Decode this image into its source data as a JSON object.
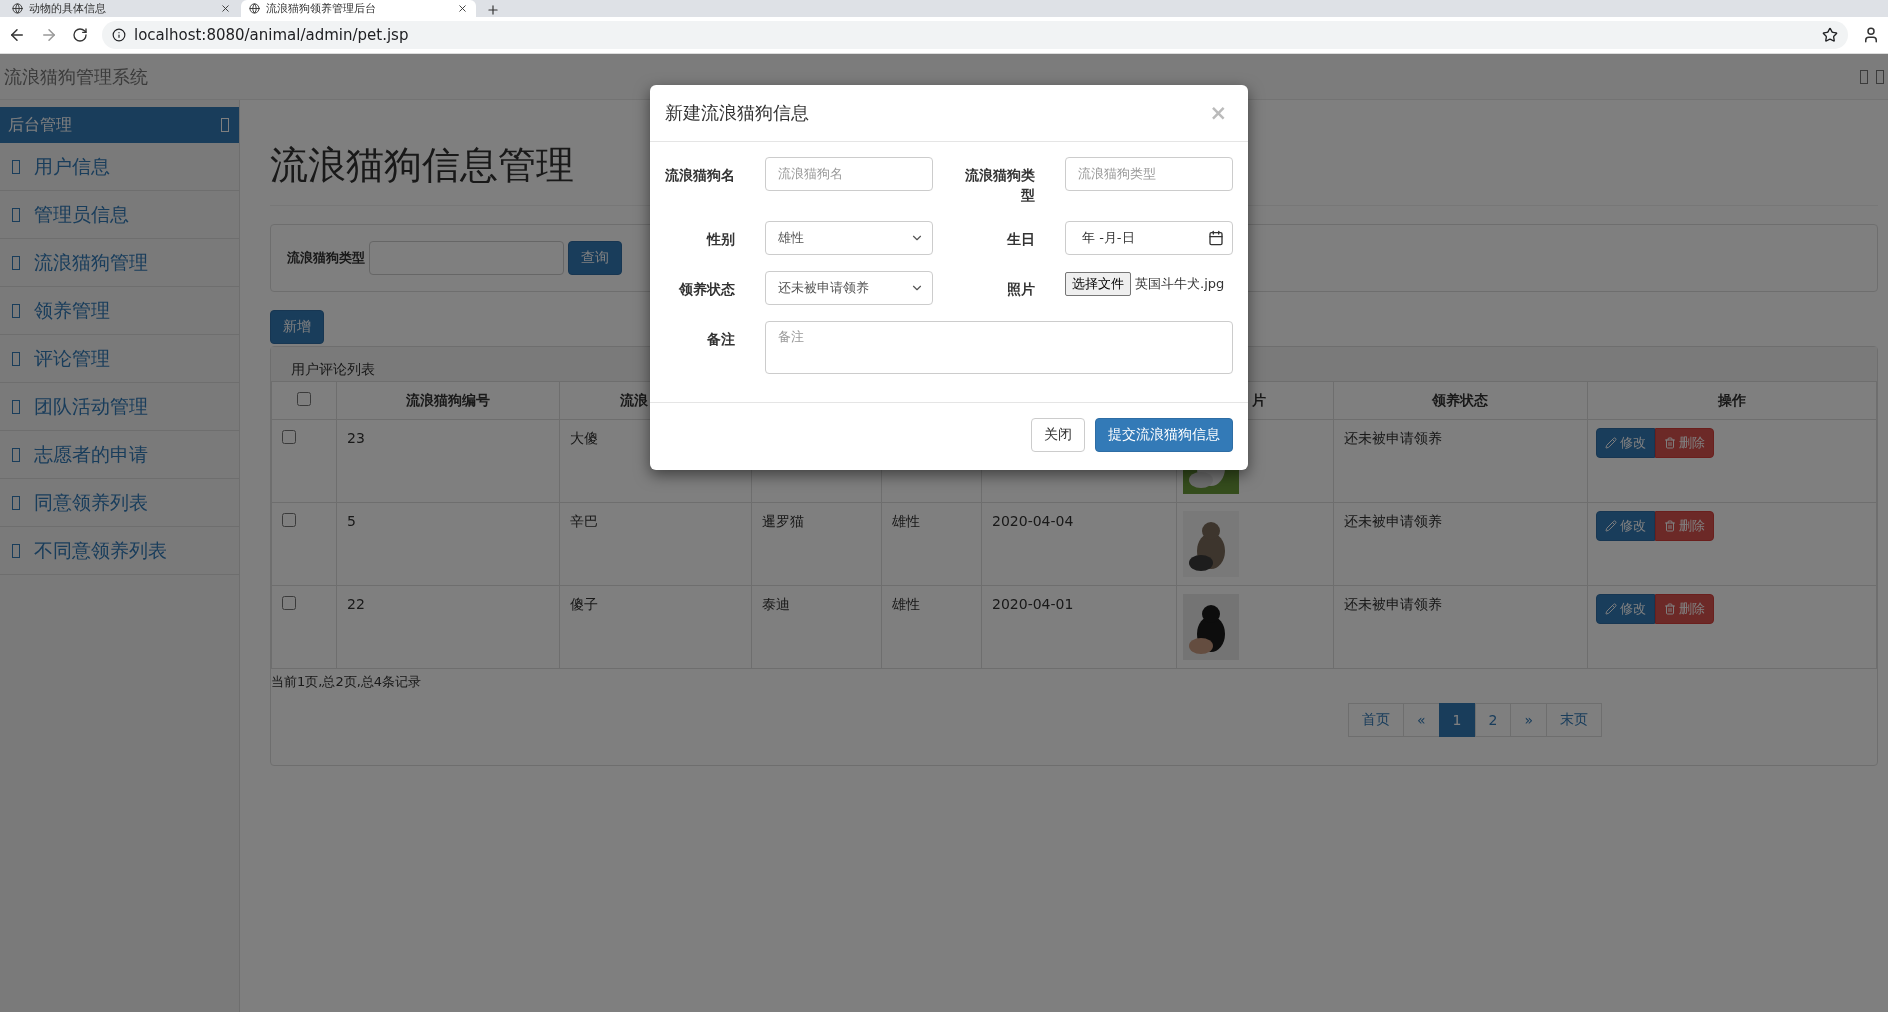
{
  "browser": {
    "tabs": [
      {
        "title": "动物的具体信息",
        "selected": false
      },
      {
        "title": "流浪猫狗领养管理后台",
        "selected": true
      }
    ],
    "url": "localhost:8080/animal/admin/pet.jsp"
  },
  "navbar": {
    "title": "流浪猫狗管理系统"
  },
  "sidebar": {
    "header": "后台管理",
    "items": [
      {
        "label": "用户信息"
      },
      {
        "label": "管理员信息"
      },
      {
        "label": "流浪猫狗管理"
      },
      {
        "label": "领养管理"
      },
      {
        "label": "评论管理"
      },
      {
        "label": "团队活动管理"
      },
      {
        "label": "志愿者的申请"
      },
      {
        "label": "同意领养列表"
      },
      {
        "label": "不同意领养列表"
      }
    ]
  },
  "page": {
    "heading": "流浪猫狗信息管理",
    "search": {
      "label": "流浪猫狗类型",
      "button": "查询"
    },
    "add_button": "新增",
    "table": {
      "caption": "用户评论列表",
      "header_checked": false,
      "columns": [
        {
          "label": "流浪猫狗编号"
        },
        {
          "label": "流浪"
        },
        {},
        {},
        {},
        {
          "label": "片"
        },
        {
          "label": "领养状态"
        },
        {
          "label": "操作"
        }
      ],
      "rows": [
        {
          "checked": false,
          "id": "23",
          "name": "大傻",
          "status": "还未被申请领养",
          "edit": "修改",
          "delete": "删除"
        },
        {
          "checked": false,
          "id": "5",
          "name": "辛巴",
          "type": "暹罗猫",
          "sex": "雄性",
          "birthday": "2020-04-04",
          "status": "还未被申请领养",
          "edit": "修改",
          "delete": "删除"
        },
        {
          "checked": false,
          "id": "22",
          "name": "傻子",
          "type": "泰迪",
          "sex": "雄性",
          "birthday": "2020-04-01",
          "status": "还未被申请领养",
          "edit": "修改",
          "delete": "删除"
        }
      ]
    },
    "summary": "当前1页,总2页,总4条记录",
    "pagination": [
      {
        "label": "首页",
        "selected": false
      },
      {
        "label": "«",
        "selected": false
      },
      {
        "label": "1",
        "selected": true
      },
      {
        "label": "2",
        "selected": false
      },
      {
        "label": "»",
        "selected": false
      },
      {
        "label": "末页",
        "selected": false
      }
    ]
  },
  "modal": {
    "title": "新建流浪猫狗信息",
    "close": "×",
    "fields": [
      {
        "kind": "text",
        "label": "流浪猫狗名",
        "placeholder": "流浪猫狗名"
      },
      {
        "kind": "text",
        "label": "流浪猫狗类型",
        "placeholder": "流浪猫狗类型"
      },
      {
        "kind": "select",
        "label": "性别",
        "value": "雄性"
      },
      {
        "kind": "date",
        "label": "生日",
        "value": "年 -月-日"
      },
      {
        "kind": "select",
        "label": "领养状态",
        "value": "还未被申请领养"
      },
      {
        "kind": "file",
        "label": "照片",
        "button": "选择文件",
        "value": "英国斗牛犬.jpg"
      },
      {
        "kind": "textarea",
        "label": "备注",
        "placeholder": "备注"
      }
    ],
    "buttons": [
      {
        "kind": "default",
        "label": "关闭"
      },
      {
        "kind": "primary",
        "label": "提交流浪猫狗信息"
      }
    ]
  }
}
